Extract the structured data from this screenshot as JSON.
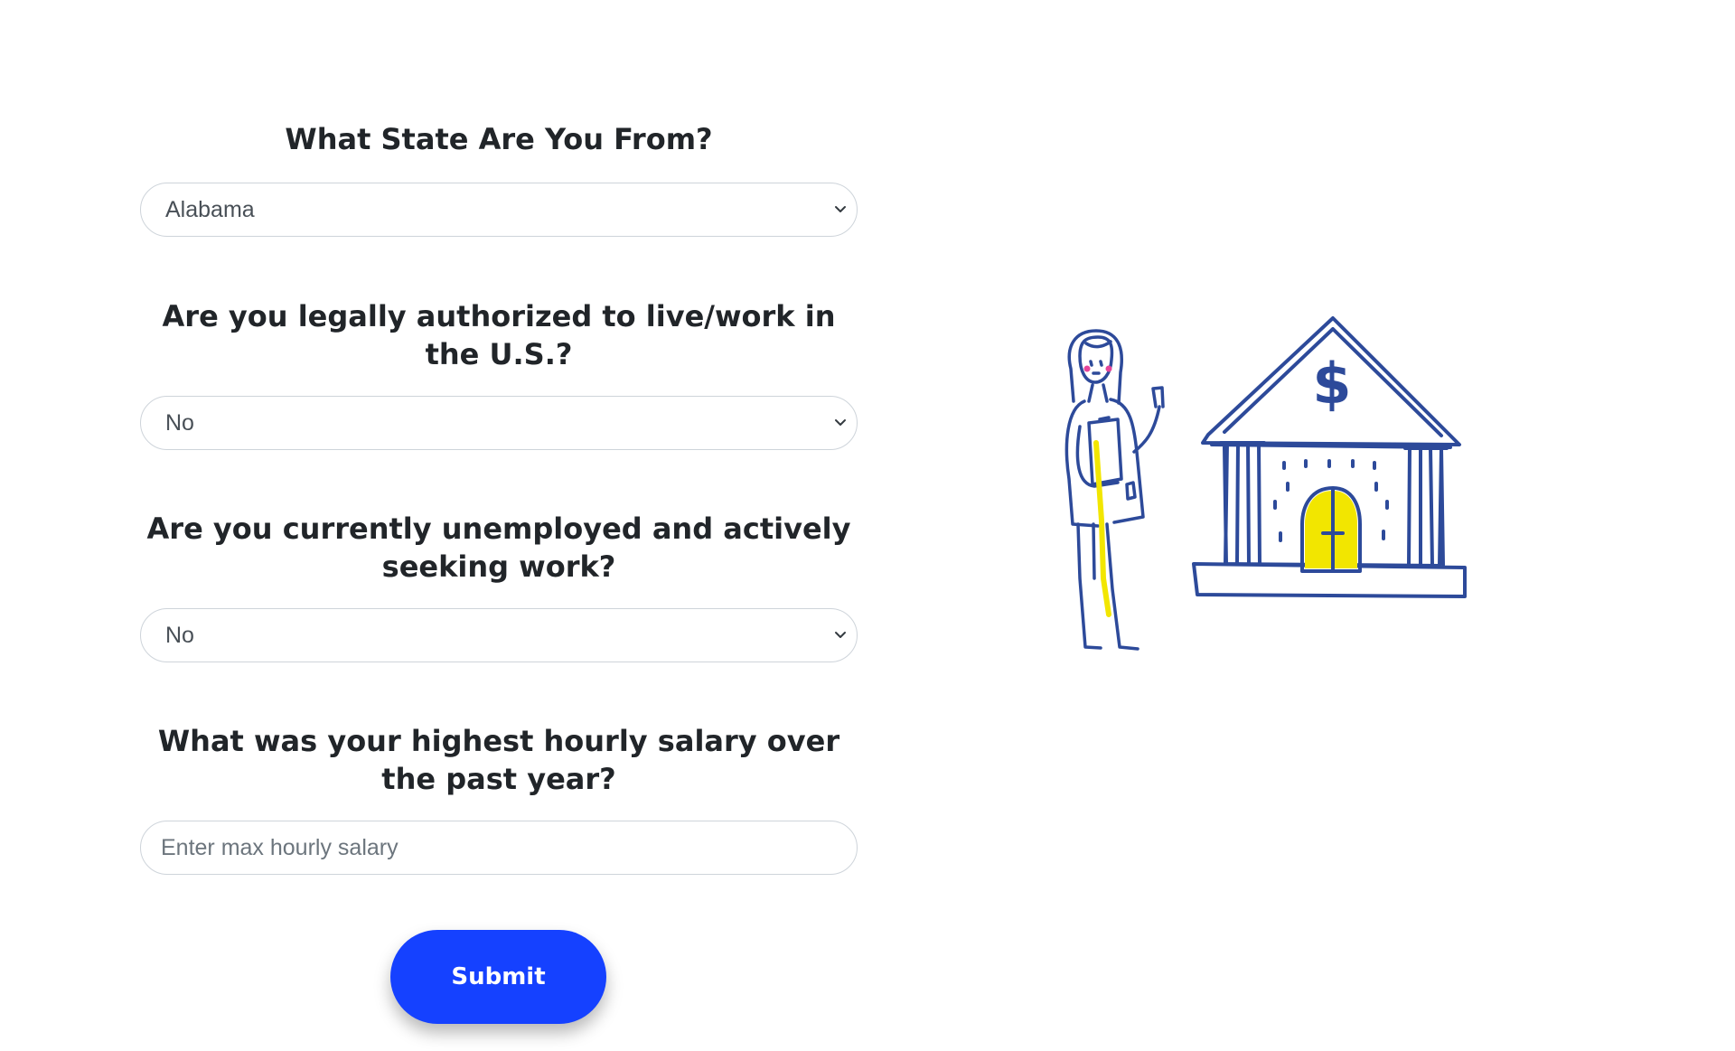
{
  "questions": {
    "state": {
      "label": "What State Are You From?",
      "selected": "Alabama"
    },
    "authorized": {
      "label": "Are you legally authorized to live/work in the U.S.?",
      "selected": "No"
    },
    "unemployed": {
      "label": "Are you currently unemployed and actively seeking work?",
      "selected": "No"
    },
    "salary": {
      "label": "What was your highest hourly salary over the past year?",
      "value": "",
      "placeholder": "Enter max hourly salary"
    }
  },
  "submit": {
    "label": "Submit"
  },
  "illustration": {
    "icon": "bank-with-person-illustration",
    "bank_symbol": "$"
  },
  "colors": {
    "primary_button": "#1541ff",
    "illustration_stroke": "#2d4a9a",
    "illustration_accent": "#f2e600",
    "heading_text": "#212529"
  }
}
